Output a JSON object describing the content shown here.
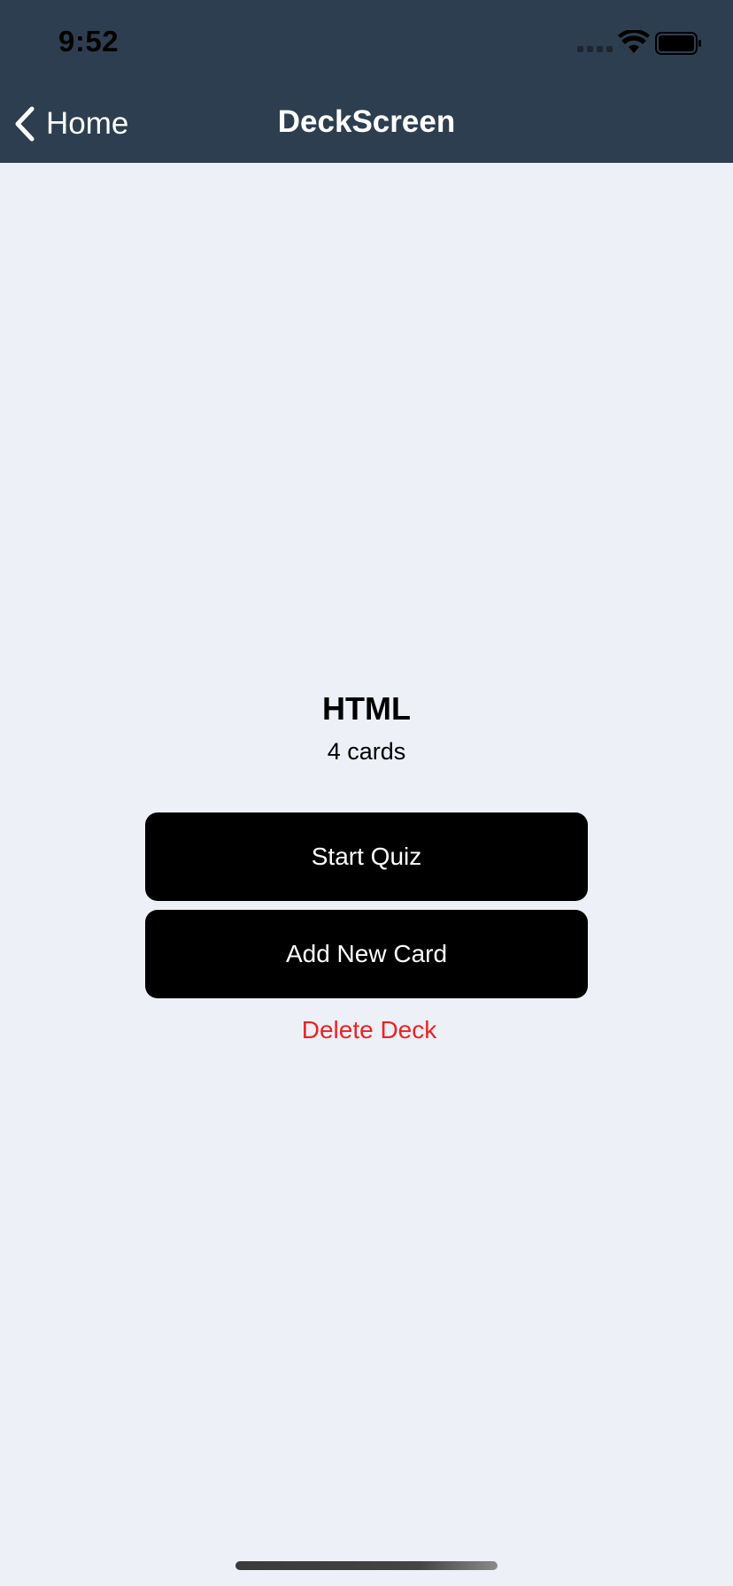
{
  "status_bar": {
    "time": "9:52"
  },
  "nav": {
    "back_label": "Home",
    "title": "DeckScreen"
  },
  "deck": {
    "title": "HTML",
    "count_label": "4 cards"
  },
  "actions": {
    "start_quiz_label": "Start Quiz",
    "add_card_label": "Add New Card",
    "delete_label": "Delete Deck"
  },
  "colors": {
    "header_bg": "#2e3e51",
    "page_bg": "#edf0f7",
    "button_bg": "#000000",
    "delete_text": "#ee2222"
  },
  "icons": {
    "back": "chevron-left-icon",
    "wifi": "wifi-icon",
    "battery": "battery-icon",
    "signal": "cellular-signal-icon"
  }
}
